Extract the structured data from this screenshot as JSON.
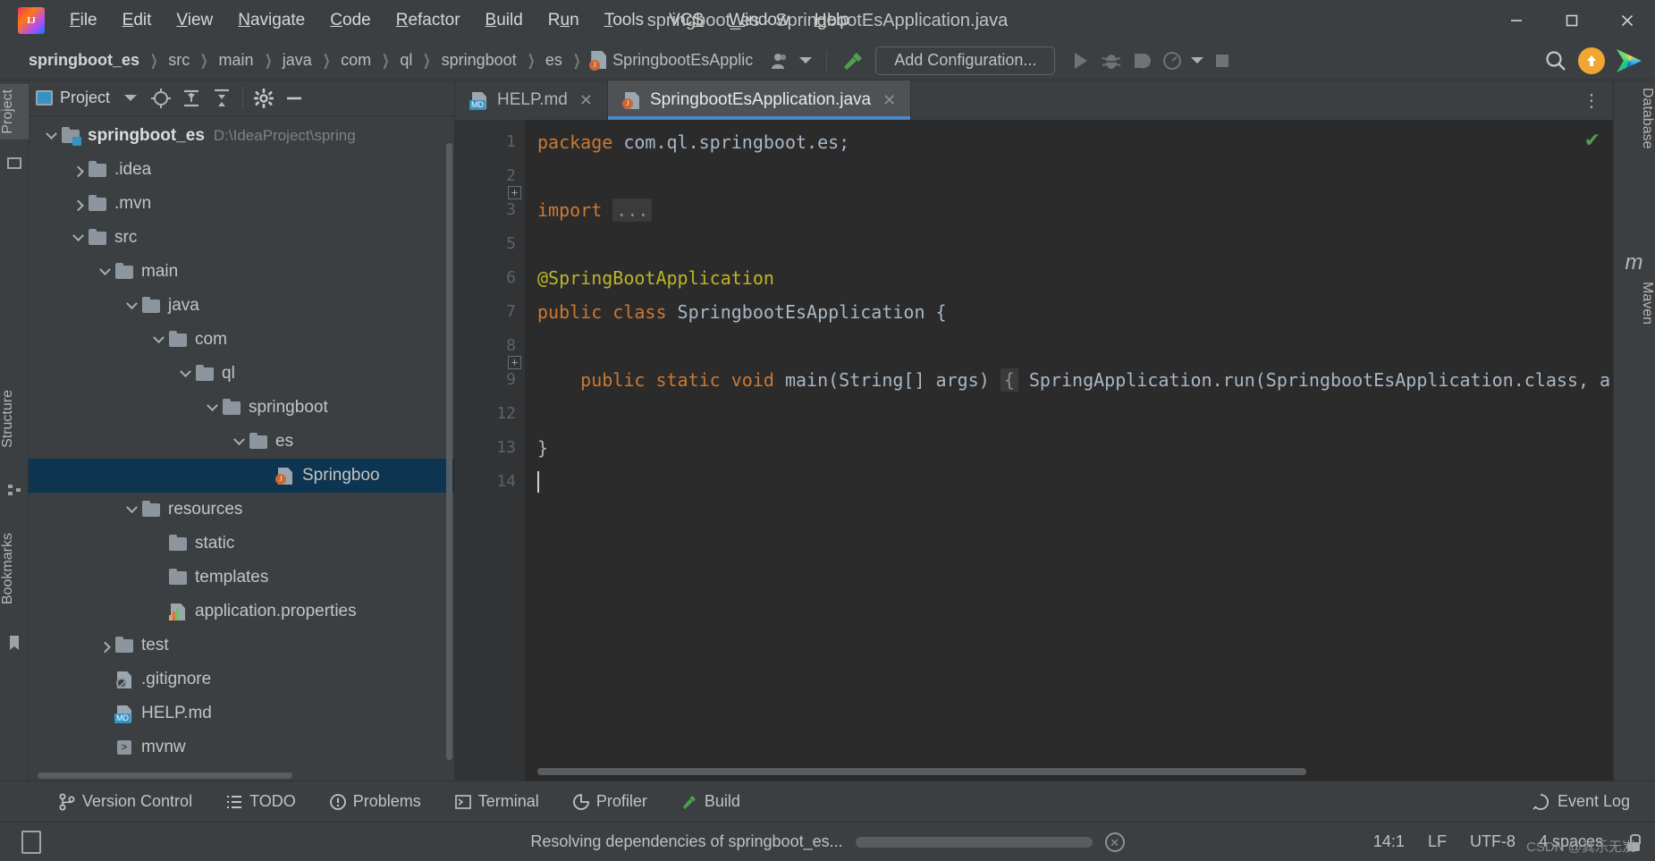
{
  "window": {
    "title": "springboot_es - SpringbootEsApplication.java",
    "minimize_label": "─",
    "maximize_label": "☐",
    "close_label": "✕"
  },
  "menubar": [
    {
      "label": "File",
      "mnemonic": "F"
    },
    {
      "label": "Edit",
      "mnemonic": "E"
    },
    {
      "label": "View",
      "mnemonic": "V"
    },
    {
      "label": "Navigate",
      "mnemonic": "N"
    },
    {
      "label": "Code",
      "mnemonic": "C"
    },
    {
      "label": "Refactor",
      "mnemonic": "R"
    },
    {
      "label": "Build",
      "mnemonic": "B"
    },
    {
      "label": "Run",
      "mnemonic": "u"
    },
    {
      "label": "Tools",
      "mnemonic": "T"
    },
    {
      "label": "VCS",
      "mnemonic": "S"
    },
    {
      "label": "Window",
      "mnemonic": "W"
    },
    {
      "label": "Help",
      "mnemonic": "H"
    }
  ],
  "navbar": {
    "breadcrumbs": [
      "springboot_es",
      "src",
      "main",
      "java",
      "com",
      "ql",
      "springboot",
      "es",
      "SpringbootEsApplic"
    ],
    "add_configuration_label": "Add Configuration...",
    "icons": {
      "profile": "user-profile-icon",
      "hammer": "build-hammer-icon",
      "run": "run-icon",
      "debug": "debug-icon",
      "coverage": "run-with-coverage-icon",
      "profiler": "profile-icon",
      "stop": "stop-icon",
      "search": "search-everywhere-icon",
      "update": "update-project-icon",
      "plugin": "rainbow-plugin-icon"
    }
  },
  "left_rail": [
    {
      "label": "Project",
      "active": true
    },
    {
      "label": "Structure",
      "active": false
    },
    {
      "label": "Bookmarks",
      "active": false
    }
  ],
  "right_rail": [
    {
      "label": "Database"
    },
    {
      "label": "Maven"
    }
  ],
  "project_panel": {
    "title": "Project",
    "header_buttons": [
      "expand-caret",
      "locate-icon",
      "expand-all-icon",
      "collapse-all-icon",
      "settings-gear-icon",
      "hide-panel-icon"
    ],
    "tree": [
      {
        "depth": 0,
        "label": "springboot_es",
        "path": "D:\\IdeaProject\\spring",
        "icon": "module-folder",
        "arrow": "down",
        "bold": true,
        "selected": false
      },
      {
        "depth": 1,
        "label": ".idea",
        "path": "",
        "icon": "folder",
        "arrow": "right",
        "bold": false,
        "selected": false
      },
      {
        "depth": 1,
        "label": ".mvn",
        "path": "",
        "icon": "folder",
        "arrow": "right",
        "bold": false,
        "selected": false
      },
      {
        "depth": 1,
        "label": "src",
        "path": "",
        "icon": "folder",
        "arrow": "down",
        "bold": false,
        "selected": false
      },
      {
        "depth": 2,
        "label": "main",
        "path": "",
        "icon": "folder",
        "arrow": "down",
        "bold": false,
        "selected": false
      },
      {
        "depth": 3,
        "label": "java",
        "path": "",
        "icon": "folder",
        "arrow": "down",
        "bold": false,
        "selected": false
      },
      {
        "depth": 4,
        "label": "com",
        "path": "",
        "icon": "folder",
        "arrow": "down",
        "bold": false,
        "selected": false
      },
      {
        "depth": 5,
        "label": "ql",
        "path": "",
        "icon": "folder",
        "arrow": "down",
        "bold": false,
        "selected": false
      },
      {
        "depth": 6,
        "label": "springboot",
        "path": "",
        "icon": "folder",
        "arrow": "down",
        "bold": false,
        "selected": false
      },
      {
        "depth": 7,
        "label": "es",
        "path": "",
        "icon": "folder",
        "arrow": "down",
        "bold": false,
        "selected": false
      },
      {
        "depth": 8,
        "label": "Springboo",
        "path": "",
        "icon": "java",
        "arrow": "none",
        "bold": false,
        "selected": true
      },
      {
        "depth": 3,
        "label": "resources",
        "path": "",
        "icon": "folder",
        "arrow": "down",
        "bold": false,
        "selected": false
      },
      {
        "depth": 4,
        "label": "static",
        "path": "",
        "icon": "folder",
        "arrow": "none",
        "bold": false,
        "selected": false
      },
      {
        "depth": 4,
        "label": "templates",
        "path": "",
        "icon": "folder",
        "arrow": "none",
        "bold": false,
        "selected": false
      },
      {
        "depth": 4,
        "label": "application.properties",
        "path": "",
        "icon": "props",
        "arrow": "none",
        "bold": false,
        "selected": false
      },
      {
        "depth": 2,
        "label": "test",
        "path": "",
        "icon": "folder",
        "arrow": "right",
        "bold": false,
        "selected": false
      },
      {
        "depth": 2,
        "label": ".gitignore",
        "path": "",
        "icon": "gitignore",
        "arrow": "none",
        "bold": false,
        "selected": false
      },
      {
        "depth": 2,
        "label": "HELP.md",
        "path": "",
        "icon": "md",
        "arrow": "none",
        "bold": false,
        "selected": false
      },
      {
        "depth": 2,
        "label": "mvnw",
        "path": "",
        "icon": "shell",
        "arrow": "none",
        "bold": false,
        "selected": false
      }
    ]
  },
  "editor": {
    "tabs": [
      {
        "label": "HELP.md",
        "icon": "markdown-file-icon",
        "active": false
      },
      {
        "label": "SpringbootEsApplication.java",
        "icon": "java-file-icon",
        "active": true
      }
    ],
    "line_numbers": [
      "1",
      "2",
      "3",
      "5",
      "6",
      "7",
      "8",
      "9",
      "12",
      "13",
      "14"
    ],
    "code_lines": [
      {
        "n": "1",
        "segments": [
          {
            "t": "package ",
            "c": "kw"
          },
          {
            "t": "com.ql.springboot.es;",
            "c": "plain"
          }
        ]
      },
      {
        "n": "2",
        "segments": []
      },
      {
        "n": "3",
        "segments": [
          {
            "t": "import ",
            "c": "kw"
          },
          {
            "t": "...",
            "c": "fold"
          }
        ]
      },
      {
        "n": "5",
        "segments": []
      },
      {
        "n": "6",
        "segments": [
          {
            "t": "@SpringBootApplication",
            "c": "anno"
          }
        ]
      },
      {
        "n": "7",
        "segments": [
          {
            "t": "public class ",
            "c": "kw"
          },
          {
            "t": "SpringbootEsApplication {",
            "c": "plain"
          }
        ]
      },
      {
        "n": "8",
        "segments": []
      },
      {
        "n": "9",
        "segments": [
          {
            "t": "    public static void ",
            "c": "kw"
          },
          {
            "t": "main(String[] args) ",
            "c": "plain"
          },
          {
            "t": "{",
            "c": "fold"
          },
          {
            "t": " SpringApplication.run(SpringbootEsApplication.class, a",
            "c": "plain"
          }
        ]
      },
      {
        "n": "12",
        "segments": []
      },
      {
        "n": "13",
        "segments": [
          {
            "t": "}",
            "c": "plain"
          }
        ]
      },
      {
        "n": "14",
        "segments": [
          {
            "t": "",
            "c": "caret"
          }
        ]
      }
    ],
    "inspection_status": "✔"
  },
  "bottom_bar": {
    "items": [
      {
        "label": "Version Control",
        "icon": "branch-icon"
      },
      {
        "label": "TODO",
        "icon": "todo-list-icon"
      },
      {
        "label": "Problems",
        "icon": "problems-warning-icon"
      },
      {
        "label": "Terminal",
        "icon": "terminal-icon"
      },
      {
        "label": "Profiler",
        "icon": "profiler-icon"
      },
      {
        "label": "Build",
        "icon": "build-hammer-icon"
      }
    ],
    "event_log": {
      "label": "Event Log",
      "icon": "event-log-icon"
    }
  },
  "status_bar": {
    "message": "Resolving dependencies of springboot_es...",
    "cancel_icon": "stop-progress-icon",
    "caret_position": "14:1",
    "line_separator": "LF",
    "encoding": "UTF-8",
    "indent": "4 spaces",
    "lock_icon": "read-only-lock-icon"
  },
  "watermark": "CSDN @其乐无岌",
  "colors": {
    "background": "#3c3f41",
    "editor_background": "#2b2b2b",
    "gutter": "#313335",
    "selection": "#0d3450",
    "accent_blue": "#4a88c7",
    "keyword_orange": "#cc7832",
    "annotation_yellow": "#bbb529",
    "text": "#a9b7c6",
    "ok_green": "#4c9e52",
    "badge_orange": "#f0a732"
  }
}
